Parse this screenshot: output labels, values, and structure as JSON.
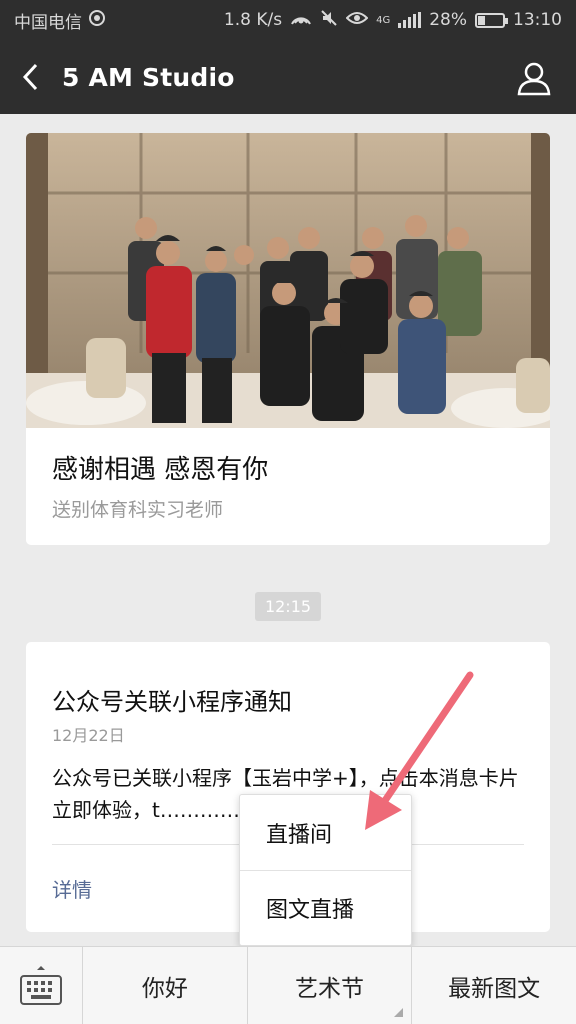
{
  "status_bar": {
    "carrier": "中国电信",
    "speed": "1.8 K/s",
    "network": "4G",
    "battery": "28%",
    "battery_level": 0.28,
    "time": "13:10"
  },
  "header": {
    "title": "5 AM Studio"
  },
  "article": {
    "title": "感谢相遇 感恩有你",
    "subtitle": "送别体育科实习老师"
  },
  "timestamp": "12:15",
  "notice": {
    "title": "公众号关联小程序通知",
    "date": "12月22日",
    "body": "公众号已关联小程序【玉岩中学+】，点击本消息卡片立即体验，t…………料页查看。",
    "detail": "详情"
  },
  "popup_menu": {
    "items": [
      "直播间",
      "图文直播"
    ]
  },
  "bottom_menu": {
    "items": [
      "你好",
      "艺术节",
      "最新图文"
    ]
  },
  "colors": {
    "header_bg": "#2e2e2e",
    "link": "#576b95",
    "arrow": "#ee6a78"
  },
  "icons": [
    "signal-icon",
    "back-icon",
    "profile-icon",
    "keyboard-icon",
    "mute-icon",
    "eye-icon"
  ]
}
